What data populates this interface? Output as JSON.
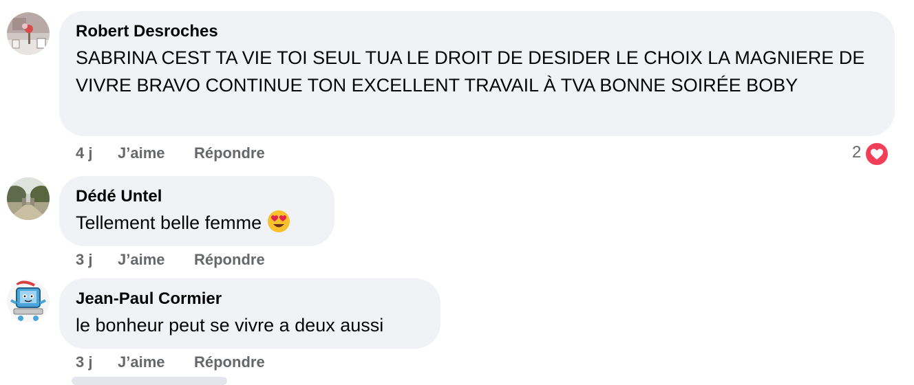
{
  "comments": [
    {
      "author": "Robert Desroches",
      "text": "SABRINA CEST TA VIE TOI SEUL TUA LE DROIT DE DESIDER LE CHOIX LA MAGNIERE DE VIVRE BRAVO CONTINUE TON EXCELLENT TRAVAIL À TVA BONNE SOIRÉE BOBY",
      "time": "4 j",
      "like_label": "J’aime",
      "reply_label": "Répondre",
      "reaction_count": "2",
      "reaction_icon": "heart-icon"
    },
    {
      "author": "Dédé Untel",
      "text": "Tellement belle femme",
      "emoji": "heart-eyes-emoji-icon",
      "time": "3 j",
      "like_label": "J’aime",
      "reply_label": "Répondre"
    },
    {
      "author": "Jean-Paul Cormier",
      "text": "le bonheur peut se vivre a deux aussi",
      "time": "3 j",
      "like_label": "J’aime",
      "reply_label": "Répondre"
    }
  ],
  "colors": {
    "bubble": "#f0f2f5",
    "meta_text": "#65676b",
    "heart": "#f33e58"
  }
}
